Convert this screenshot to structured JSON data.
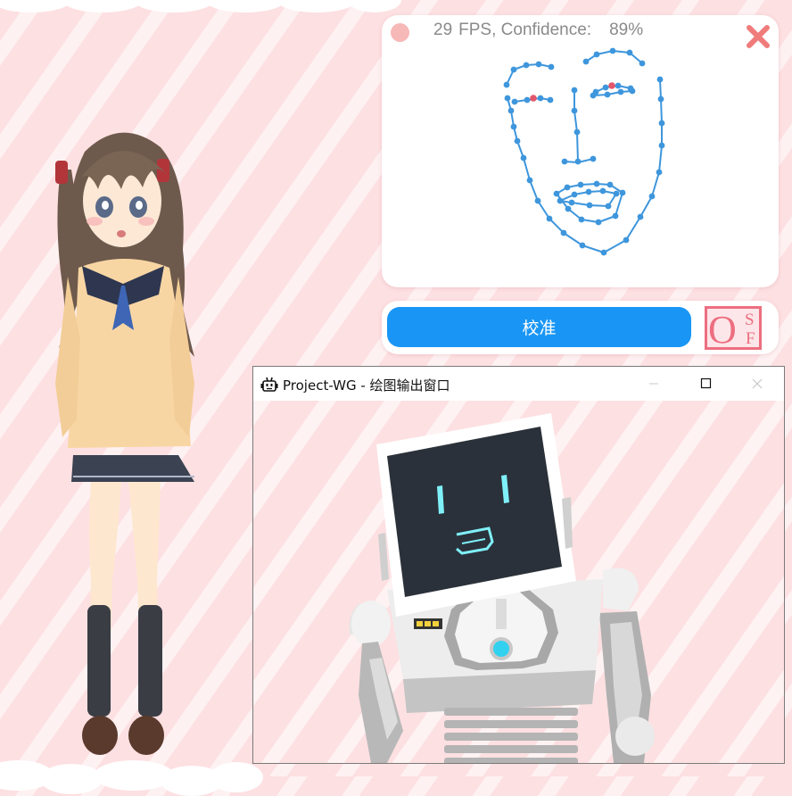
{
  "tracker": {
    "fps_value": "29",
    "fps_label": "FPS, Confidence:",
    "confidence_value": "89%"
  },
  "calibration": {
    "button_label": "校准"
  },
  "logo": {
    "big_letter": "O",
    "small_top": "S",
    "small_bottom": "F"
  },
  "output_window": {
    "title": "Project-WG - 绘图输出窗口"
  },
  "colors": {
    "background": "#fde0e2",
    "accent_blue": "#1996f5",
    "mesh_blue": "#3e96dc",
    "close_red": "#f07b7b"
  }
}
